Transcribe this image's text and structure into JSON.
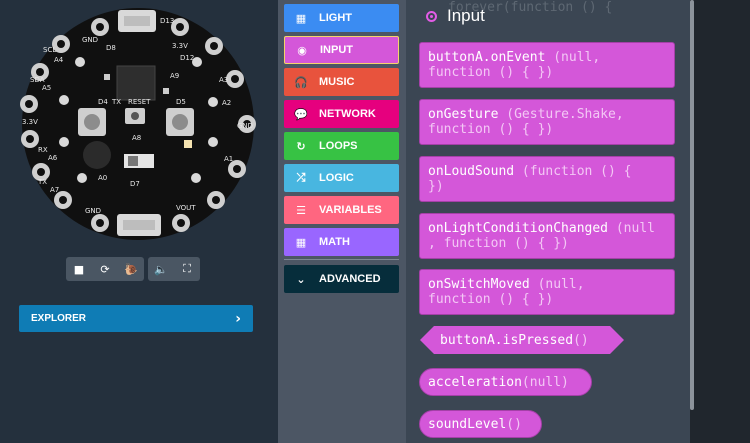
{
  "simulator": {
    "board_labels": [
      "D13",
      "GND",
      "D8",
      "3.3V",
      "D12",
      "SCL",
      "A4",
      "SDA",
      "A5",
      "3.3V",
      "RX",
      "A6",
      "TX",
      "A7",
      "A8",
      "A9",
      "RESET",
      "D4",
      "D5",
      "TX",
      "D7",
      "VOUT",
      "GND",
      "A0",
      "A1",
      "A2",
      "A3",
      "GND"
    ],
    "toolbar_icons": [
      "stop-icon",
      "restart-icon",
      "slow-mode-icon",
      "sound-icon",
      "fullscreen-icon"
    ]
  },
  "explorer": {
    "label": "EXPLORER"
  },
  "toolbox": {
    "categories": [
      {
        "label": "LIGHT",
        "icon": "grid-icon",
        "color": "#3b8cf2"
      },
      {
        "label": "INPUT",
        "icon": "target-icon",
        "color": "#d457d9",
        "selected": true
      },
      {
        "label": "MUSIC",
        "icon": "headphones-icon",
        "color": "#e8533d"
      },
      {
        "label": "NETWORK",
        "icon": "chat-icon",
        "color": "#e6007e"
      },
      {
        "label": "LOOPS",
        "icon": "refresh-icon",
        "color": "#37c244"
      },
      {
        "label": "LOGIC",
        "icon": "shuffle-icon",
        "color": "#48b6e0"
      },
      {
        "label": "VARIABLES",
        "icon": "list-icon",
        "color": "#ff6680"
      },
      {
        "label": "MATH",
        "icon": "calculator-icon",
        "color": "#9966ff"
      },
      {
        "label": "ADVANCED",
        "icon": "chevron-down-icon",
        "color": "#062d3b"
      }
    ]
  },
  "background_code": "forever(function () {",
  "flyout": {
    "title": "Input",
    "blocks": [
      {
        "name": "buttonA.onEvent",
        "args": " (null,",
        "line2": "function () { })"
      },
      {
        "name": "onGesture",
        "args": " (Gesture.Shake,",
        "line2": "function () { })"
      },
      {
        "name": "onLoudSound",
        "args": " (function () {",
        "line2": "})"
      },
      {
        "name": "onLightConditionChanged",
        "args": " (null",
        "line2": ", function () { })"
      },
      {
        "name": "onSwitchMoved",
        "args": " (null,",
        "line2": "function () { })"
      }
    ],
    "reporters": [
      {
        "name": "buttonA.isPressed",
        "args": " ()"
      },
      {
        "name": "acceleration",
        "args": " (null)"
      },
      {
        "name": "soundLevel",
        "args": " ()"
      }
    ]
  }
}
